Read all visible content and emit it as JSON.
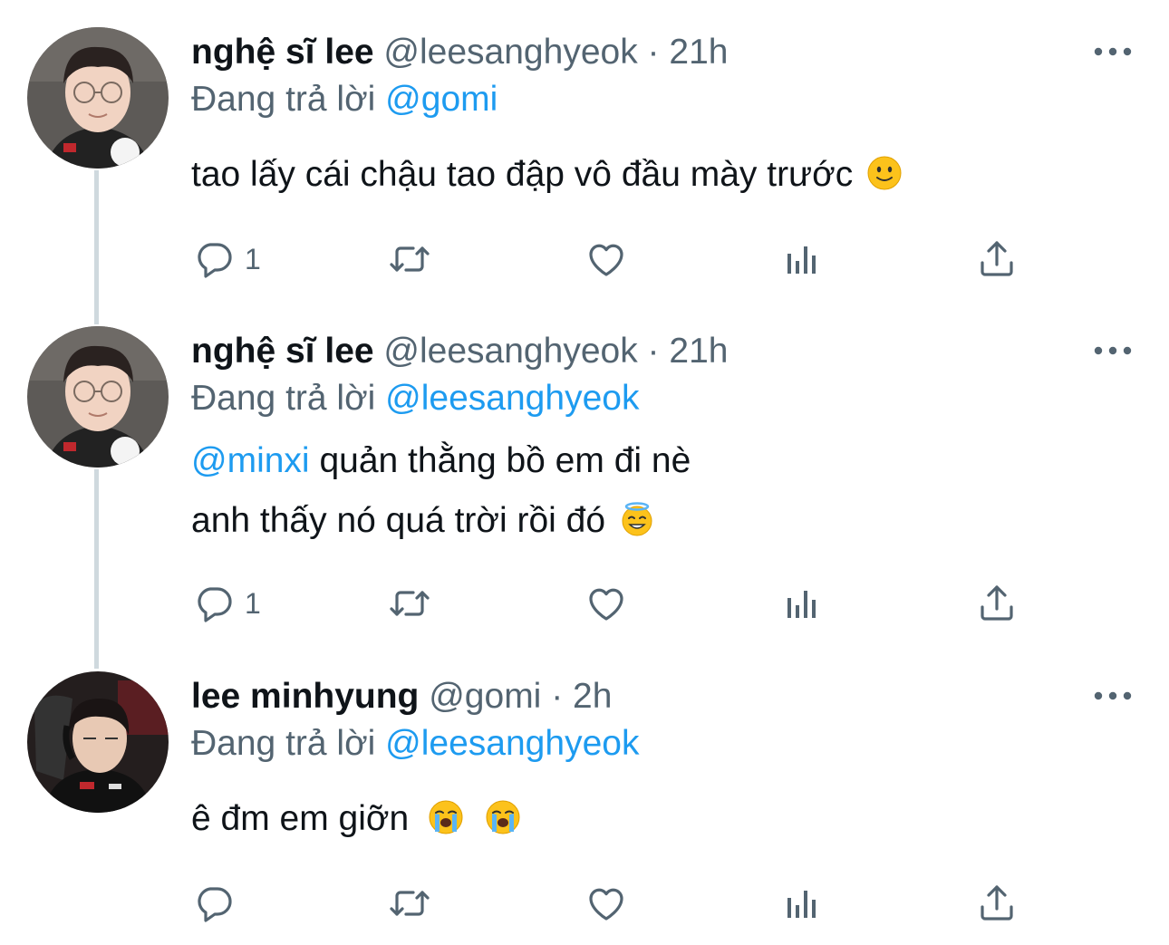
{
  "colors": {
    "accent": "#1d9bf0",
    "muted": "#536471",
    "text": "#0f1419",
    "thread_line": "#cfd9de"
  },
  "tweets": [
    {
      "display_name": "nghệ sĩ lee",
      "handle": "@leesanghyeok",
      "separator": "·",
      "time": "21h",
      "replying_prefix": "Đang trả lời",
      "replying_to": "@gomi",
      "lines": [
        {
          "mention": "",
          "text": "tao lấy cái chậu tao đập vô đầu mày trước",
          "emojis": [
            "slightly-smiling-face"
          ]
        }
      ],
      "reply_count": "1",
      "icons": [
        "reply-icon",
        "retweet-icon",
        "like-icon",
        "analytics-icon",
        "share-icon",
        "more-icon"
      ]
    },
    {
      "display_name": "nghệ sĩ lee",
      "handle": "@leesanghyeok",
      "separator": "·",
      "time": "21h",
      "replying_prefix": "Đang trả lời",
      "replying_to": "@leesanghyeok",
      "lines": [
        {
          "mention": "@minxi",
          "text": " quản thằng bồ em đi nè",
          "emojis": []
        },
        {
          "mention": "",
          "text": "anh thấy nó quá trời rồi đó",
          "emojis": [
            "smiling-face-with-halo"
          ]
        }
      ],
      "reply_count": "1",
      "icons": [
        "reply-icon",
        "retweet-icon",
        "like-icon",
        "analytics-icon",
        "share-icon",
        "more-icon"
      ]
    },
    {
      "display_name": "lee minhyung",
      "handle": "@gomi",
      "separator": "·",
      "time": "2h",
      "replying_prefix": "Đang trả lời",
      "replying_to": "@leesanghyeok",
      "lines": [
        {
          "mention": "",
          "text": "ê đm em giỡn",
          "emojis": [
            "loudly-crying-face",
            "loudly-crying-face"
          ]
        }
      ],
      "reply_count": "",
      "icons": [
        "reply-icon",
        "retweet-icon",
        "like-icon",
        "analytics-icon",
        "share-icon",
        "more-icon"
      ]
    }
  ]
}
